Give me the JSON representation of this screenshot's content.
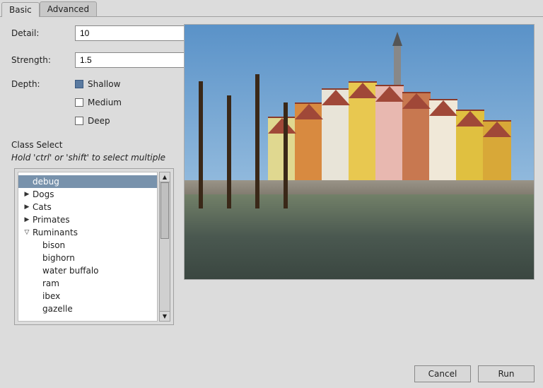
{
  "tabs": {
    "basic": "Basic",
    "advanced": "Advanced"
  },
  "form": {
    "detail_label": "Detail:",
    "detail_value": "10",
    "strength_label": "Strength:",
    "strength_value": "1.5",
    "depth_label": "Depth:",
    "depth_options": {
      "shallow": "Shallow",
      "medium": "Medium",
      "deep": "Deep"
    },
    "depth_selected": "shallow"
  },
  "class_select": {
    "title": "Class Select",
    "hint": "Hold 'ctrl' or 'shift' to select multiple"
  },
  "tree": {
    "debug": "debug",
    "dogs": "Dogs",
    "cats": "Cats",
    "primates": "Primates",
    "ruminants": "Ruminants",
    "ruminants_children": {
      "bison": "bison",
      "bighorn": "bighorn",
      "water_buffalo": "water buffalo",
      "ram": "ram",
      "ibex": "ibex",
      "gazelle": "gazelle"
    }
  },
  "buttons": {
    "cancel": "Cancel",
    "run": "Run"
  }
}
